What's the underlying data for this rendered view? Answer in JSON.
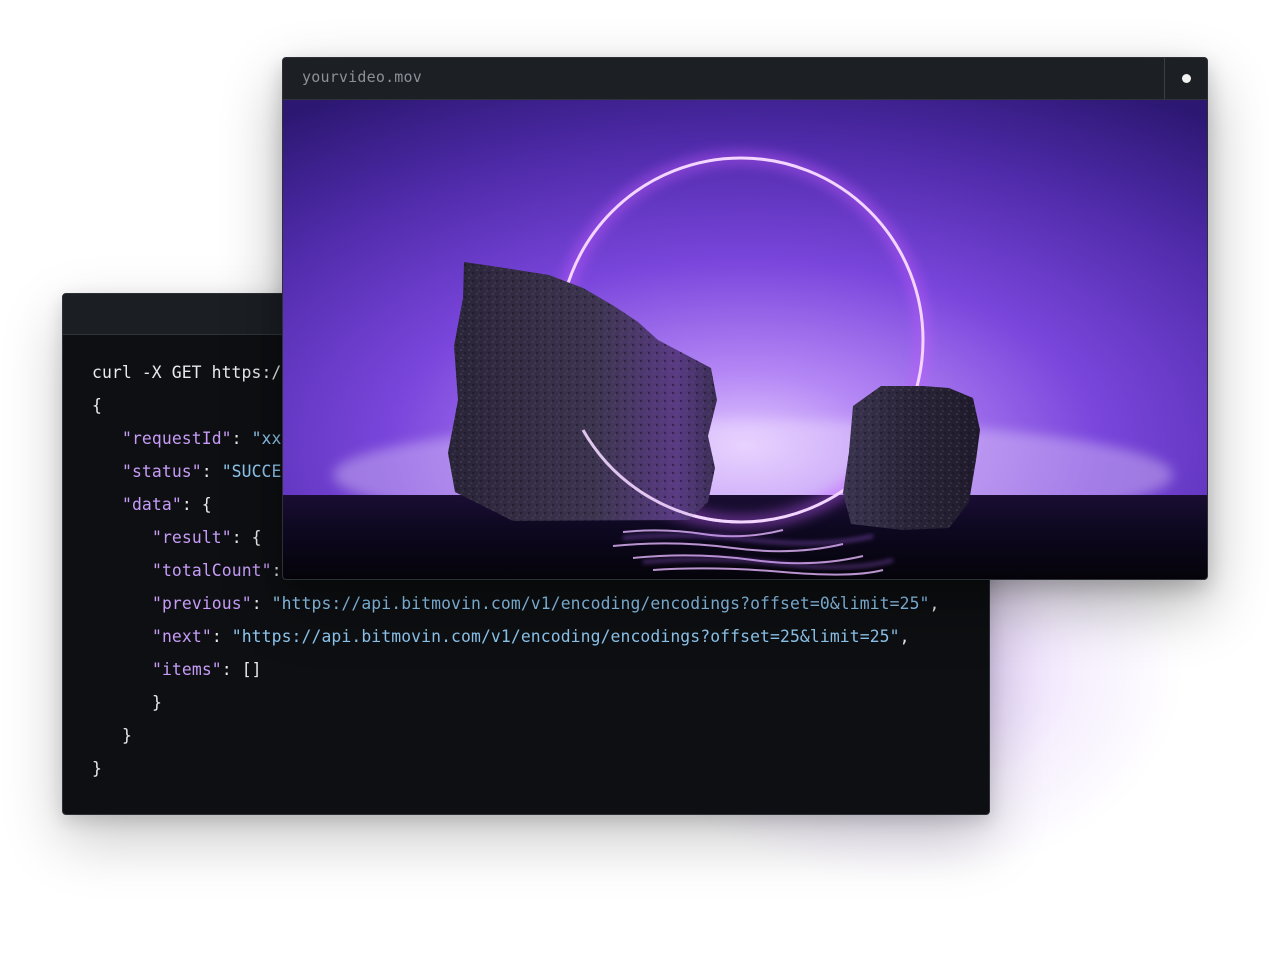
{
  "code_window": {
    "lines": [
      {
        "indent": 0,
        "parts": [
          {
            "t": "curl -X GET https:/",
            "c": "p"
          }
        ]
      },
      {
        "indent": 0,
        "parts": [
          {
            "t": "{",
            "c": "p"
          }
        ]
      },
      {
        "indent": 1,
        "parts": [
          {
            "t": "\"requestId\"",
            "c": "k"
          },
          {
            "t": ": ",
            "c": "p"
          },
          {
            "t": "\"xx",
            "c": "s"
          }
        ]
      },
      {
        "indent": 1,
        "parts": [
          {
            "t": "\"status\"",
            "c": "k"
          },
          {
            "t": ": ",
            "c": "p"
          },
          {
            "t": "\"SUCCES",
            "c": "s"
          }
        ]
      },
      {
        "indent": 1,
        "parts": [
          {
            "t": "\"data\"",
            "c": "k"
          },
          {
            "t": ": {",
            "c": "p"
          }
        ]
      },
      {
        "indent": 2,
        "parts": [
          {
            "t": "\"result\"",
            "c": "k"
          },
          {
            "t": ": {",
            "c": "p"
          }
        ]
      },
      {
        "indent": 2,
        "parts": [
          {
            "t": "\"totalCount\"",
            "c": "k"
          },
          {
            "t": ":",
            "c": "p"
          }
        ]
      },
      {
        "indent": 2,
        "parts": [
          {
            "t": "\"previous\"",
            "c": "k"
          },
          {
            "t": ": ",
            "c": "p"
          },
          {
            "t": "\"https://api.bitmovin.com/v1/encoding/encodings?offset=0&limit=25\"",
            "c": "s"
          },
          {
            "t": ",",
            "c": "p"
          }
        ]
      },
      {
        "indent": 2,
        "parts": [
          {
            "t": "\"next\"",
            "c": "k"
          },
          {
            "t": ": ",
            "c": "p"
          },
          {
            "t": "\"https://api.bitmovin.com/v1/encoding/encodings?offset=25&limit=25\"",
            "c": "s"
          },
          {
            "t": ",",
            "c": "p"
          }
        ]
      },
      {
        "indent": 2,
        "parts": [
          {
            "t": "\"items\"",
            "c": "k"
          },
          {
            "t": ": []",
            "c": "p"
          }
        ]
      },
      {
        "indent": 2,
        "parts": [
          {
            "t": "}",
            "c": "p"
          }
        ]
      },
      {
        "indent": 1,
        "parts": [
          {
            "t": "}",
            "c": "p"
          }
        ]
      },
      {
        "indent": 0,
        "parts": [
          {
            "t": "}",
            "c": "p"
          }
        ]
      }
    ]
  },
  "video_window": {
    "title": "yourvideo.mov",
    "status_icon": "dot-icon"
  },
  "colors": {
    "key": "#c69cf7",
    "string": "#8fc8f0",
    "punct": "#e8eaed",
    "accent_purple": "#9b4dff"
  }
}
